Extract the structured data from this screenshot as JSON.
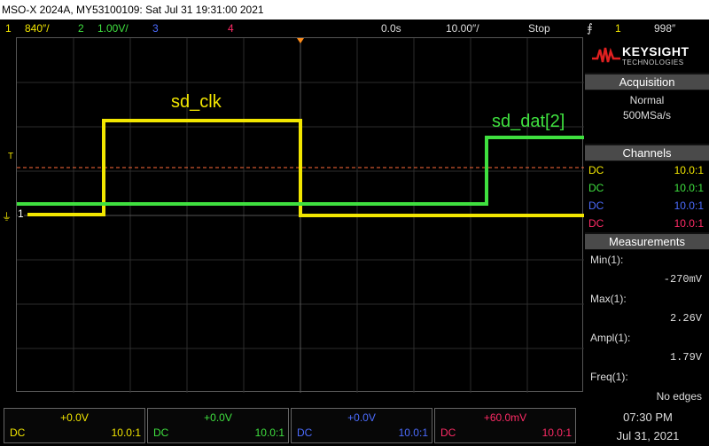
{
  "title": "MSO-X 2024A, MY53100109: Sat Jul 31 19:31:00 2021",
  "status": {
    "ch1_num": "1",
    "ch1_scale": "840″/",
    "ch2_num": "2",
    "ch2_scale": "1.00V/",
    "ch3_num": "3",
    "ch4_num": "4",
    "delay": "0.0s",
    "timebase": "10.00″/",
    "run_state": "Stop",
    "trigger_src": "1",
    "trigger_level": "998″"
  },
  "waveform_labels": {
    "clk": "sd_clk",
    "dat": "sd_dat[2]",
    "ch1_marker": "1",
    "trig_marker": "T"
  },
  "brand": {
    "name": "KEYSIGHT",
    "sub": "TECHNOLOGIES"
  },
  "acquisition": {
    "title": "Acquisition",
    "mode": "Normal",
    "rate": "500MSa/s"
  },
  "channels": {
    "title": "Channels",
    "rows": [
      {
        "coupling": "DC",
        "ratio": "10.0:1"
      },
      {
        "coupling": "DC",
        "ratio": "10.0:1"
      },
      {
        "coupling": "DC",
        "ratio": "10.0:1"
      },
      {
        "coupling": "DC",
        "ratio": "10.0:1"
      }
    ]
  },
  "measurements": {
    "title": "Measurements",
    "items": [
      {
        "label": "Min(1):",
        "value": "-270mV"
      },
      {
        "label": "Max(1):",
        "value": "2.26V"
      },
      {
        "label": "Ampl(1):",
        "value": "1.79V"
      },
      {
        "label": "Freq(1):",
        "value": "No edges"
      }
    ]
  },
  "bottom_channels": [
    {
      "offset": "+0.0V",
      "coupling": "DC",
      "ratio": "10.0:1",
      "color": "#f2e600"
    },
    {
      "offset": "+0.0V",
      "coupling": "DC",
      "ratio": "10.0:1",
      "color": "#3fe03f"
    },
    {
      "offset": "+0.0V",
      "coupling": "DC",
      "ratio": "10.0:1",
      "color": "#4c6cff"
    },
    {
      "offset": "+60.0mV",
      "coupling": "DC",
      "ratio": "10.0:1",
      "color": "#ff2b66"
    }
  ],
  "clock": {
    "time": "07:30 PM",
    "date": "Jul 31, 2021"
  },
  "colors": {
    "ch1": "#f2e600",
    "ch2": "#3fe03f",
    "ch3": "#4c6cff",
    "ch4": "#ff2b66",
    "trigger_line": "#ff6a3a"
  }
}
